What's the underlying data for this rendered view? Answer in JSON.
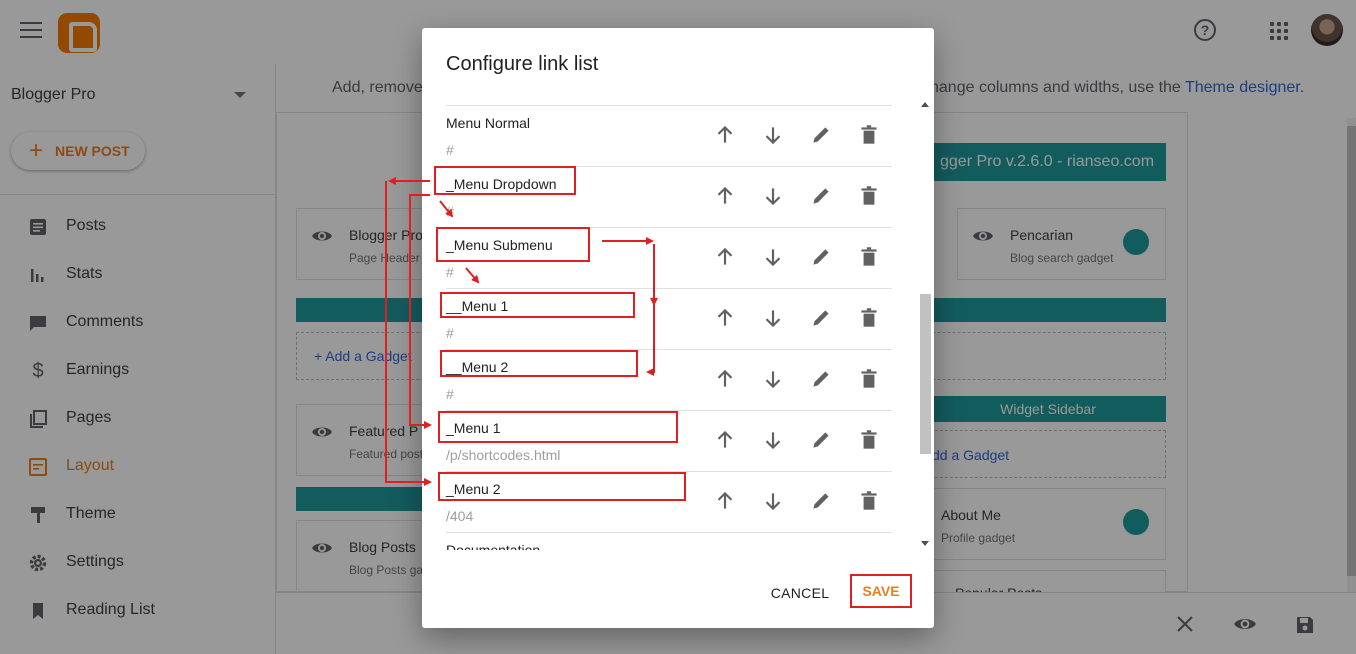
{
  "header": {
    "menu_icon": "menu-icon",
    "logo_icon": "blogger-logo-icon",
    "help_label": "?",
    "apps_icon": "apps-grid-icon",
    "avatar_icon": "user-avatar"
  },
  "sidebar": {
    "blog_name": "Blogger Pro",
    "new_post_label": "NEW POST",
    "items": [
      {
        "label": "Posts",
        "icon": "posts-icon"
      },
      {
        "label": "Stats",
        "icon": "stats-icon"
      },
      {
        "label": "Comments",
        "icon": "comments-icon"
      },
      {
        "label": "Earnings",
        "icon": "earnings-icon"
      },
      {
        "label": "Pages",
        "icon": "pages-icon"
      },
      {
        "label": "Layout",
        "icon": "layout-icon",
        "active": true
      },
      {
        "label": "Theme",
        "icon": "theme-icon"
      },
      {
        "label": "Settings",
        "icon": "settings-icon"
      },
      {
        "label": "Reading List",
        "icon": "reading-list-icon"
      }
    ]
  },
  "main": {
    "intro_left": "Add, remove",
    "intro_right": "hange columns and widths, use the",
    "theme_link": "Theme designer",
    "theme_link_suffix": ".",
    "header_bar": "gger Pro v.2.6.0 - rianseo.com",
    "gadgets": {
      "blogger_pro_title": "Blogger Pro",
      "blogger_pro_sub": "Page Header",
      "pencarian_title": "Pencarian",
      "pencarian_sub": "Blog search gadget",
      "featured_title": "Featured P",
      "featured_sub": "Featured post",
      "widget_sidebar": "Widget Sidebar",
      "add_gadget_1": "Add a Gadget",
      "add_gadget_2": "dd a Gadget",
      "about_title": "About Me",
      "about_sub": "Profile gadget",
      "blog_posts_title": "Blog Posts",
      "blog_posts_sub": "Blog Posts ga",
      "popular_title": "Popular Posts"
    }
  },
  "dialog": {
    "title": "Configure link list",
    "links": [
      {
        "label": "Menu Normal",
        "url": "#"
      },
      {
        "label": "_Menu Dropdown",
        "url": "#"
      },
      {
        "label": "_Menu Submenu",
        "url": "#"
      },
      {
        "label": "__Menu 1",
        "url": "#"
      },
      {
        "label": "__Menu 2",
        "url": "#"
      },
      {
        "label": "_Menu 1",
        "url": "/p/shortcodes.html"
      },
      {
        "label": "_Menu 2",
        "url": "/404"
      },
      {
        "label": "Documentation",
        "url": ""
      }
    ],
    "cancel_label": "CANCEL",
    "save_label": "SAVE"
  },
  "colors": {
    "accent": "#e67e22",
    "teal": "#20999d",
    "link": "#3367d6",
    "annotation": "#e02020"
  }
}
